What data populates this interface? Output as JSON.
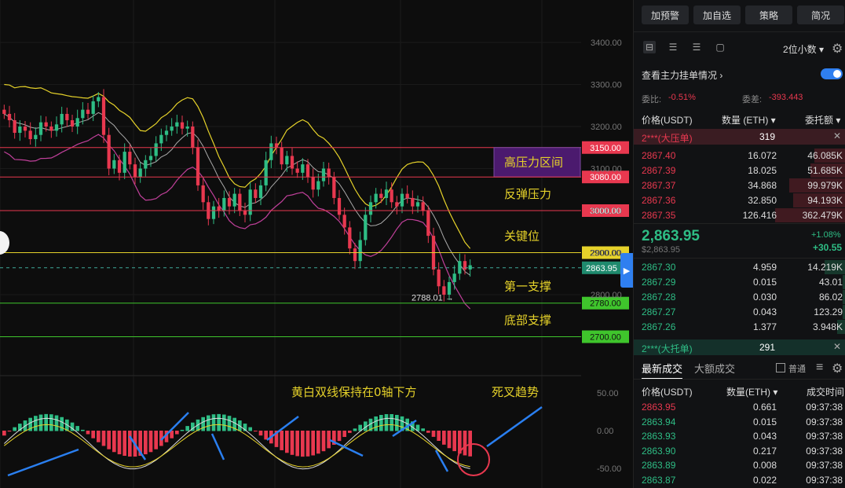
{
  "toolbar": {
    "buttons": [
      "加预警",
      "加自选",
      "策略",
      "简况"
    ]
  },
  "decimal_select": "2位小数",
  "main_orders_label": "查看主力挂单情况",
  "ratio": {
    "label": "委比:",
    "value": "-0.51%"
  },
  "diff": {
    "label": "委差:",
    "value": "-393.443"
  },
  "book_headers": {
    "price": "价格(USDT)",
    "qty": "数量 (ETH)",
    "amount": "委托额"
  },
  "ask_banner": {
    "label": "2***(大压单)",
    "value": "319"
  },
  "asks": [
    {
      "price": "2867.40",
      "qty": "16.072",
      "amt": "46.085K",
      "depth": 0.45
    },
    {
      "price": "2867.39",
      "qty": "18.025",
      "amt": "51.685K",
      "depth": 0.5
    },
    {
      "price": "2867.37",
      "qty": "34.868",
      "amt": "99.979K",
      "depth": 0.8
    },
    {
      "price": "2867.36",
      "qty": "32.850",
      "amt": "94.193K",
      "depth": 0.75
    },
    {
      "price": "2867.35",
      "qty": "126.416",
      "amt": "362.479K",
      "depth": 1.0
    }
  ],
  "last": {
    "price": "2,863.95",
    "ref": "$2,863.95",
    "pct": "+1.08%",
    "chg": "+30.55"
  },
  "bids": [
    {
      "price": "2867.30",
      "qty": "4.959",
      "amt": "14.219K",
      "depth": 0.3
    },
    {
      "price": "2867.29",
      "qty": "0.015",
      "amt": "43.01",
      "depth": 0.05
    },
    {
      "price": "2867.28",
      "qty": "0.030",
      "amt": "86.02",
      "depth": 0.05
    },
    {
      "price": "2867.27",
      "qty": "0.043",
      "amt": "123.29",
      "depth": 0.05
    },
    {
      "price": "2867.26",
      "qty": "1.377",
      "amt": "3.948K",
      "depth": 0.12
    }
  ],
  "bid_banner": {
    "label": "2***(大托单)",
    "value": "291"
  },
  "trade_tabs": {
    "latest": "最新成交",
    "large": "大额成交",
    "normal": "普通"
  },
  "trade_headers": {
    "price": "价格(USDT)",
    "qty": "数量(ETH)",
    "time": "成交时间"
  },
  "trades": [
    {
      "price": "2863.95",
      "qty": "0.661",
      "time": "09:37:38",
      "side": "sell"
    },
    {
      "price": "2863.94",
      "qty": "0.015",
      "time": "09:37:38",
      "side": "buy"
    },
    {
      "price": "2863.93",
      "qty": "0.043",
      "time": "09:37:38",
      "side": "buy"
    },
    {
      "price": "2863.90",
      "qty": "0.217",
      "time": "09:37:38",
      "side": "buy"
    },
    {
      "price": "2863.89",
      "qty": "0.008",
      "time": "09:37:38",
      "side": "buy"
    },
    {
      "price": "2863.87",
      "qty": "0.022",
      "time": "09:37:38",
      "side": "buy"
    }
  ],
  "colors": {
    "up": "#2ebd85",
    "down": "#e8384f",
    "accent": "#2f7ff0",
    "band": "#e6d22a"
  },
  "chart_data": {
    "type": "candlestick",
    "price_axis": [
      "3400.00",
      "3300.00",
      "3200.00",
      "3100.00",
      "3000.00",
      "2900.00",
      "2800.00"
    ],
    "macd_axis": [
      "50.00",
      "0.00",
      "-50.00"
    ],
    "levels": [
      {
        "price": 3150,
        "label": "3150.00",
        "note": "高压力区间",
        "color": "#e8384f"
      },
      {
        "price": 3080,
        "label": "3080.00",
        "note": "",
        "color": "#e8384f"
      },
      {
        "price": 3000,
        "label": "3000.00",
        "note": "反弹压力",
        "color": "#e8384f"
      },
      {
        "price": 2900,
        "label": "2900.00",
        "note": "关键位",
        "color": "#e6d22a"
      },
      {
        "price": 2780,
        "label": "2780.00",
        "note": "第一支撑",
        "color": "#3fc52c"
      },
      {
        "price": 2700,
        "label": "2700.00",
        "note": "底部支撑",
        "color": "#3fc52c"
      }
    ],
    "current_price": {
      "price": 2863.95,
      "label": "2863.95"
    },
    "low_marker": "2788.01",
    "annotations": {
      "macd_note": "黄白双线保持在0轴下方",
      "death_cross": "死叉趋势"
    },
    "closes": [
      3230,
      3215,
      3185,
      3200,
      3190,
      3170,
      3180,
      3210,
      3200,
      3190,
      3205,
      3230,
      3215,
      3200,
      3220,
      3240,
      3230,
      3260,
      3270,
      3180,
      3100,
      3120,
      3090,
      3140,
      3110,
      3080,
      3100,
      3120,
      3130,
      3160,
      3180,
      3190,
      3200,
      3210,
      3195,
      3200,
      3150,
      3060,
      3020,
      2980,
      3010,
      3000,
      3030,
      3010,
      3040,
      3000,
      2990,
      3050,
      3030,
      3060,
      3120,
      3160,
      3150,
      3110,
      3130,
      3100,
      3090,
      3110,
      3080,
      3050,
      3070,
      3100,
      3080,
      3030,
      2990,
      2960,
      2910,
      2880,
      2930,
      2990,
      3020,
      3040,
      3030,
      3050,
      3020,
      3010,
      3040,
      3030,
      3010,
      3020,
      3000,
      2940,
      2860,
      2820,
      2800,
      2830,
      2850,
      2880,
      2860,
      2870
    ]
  }
}
